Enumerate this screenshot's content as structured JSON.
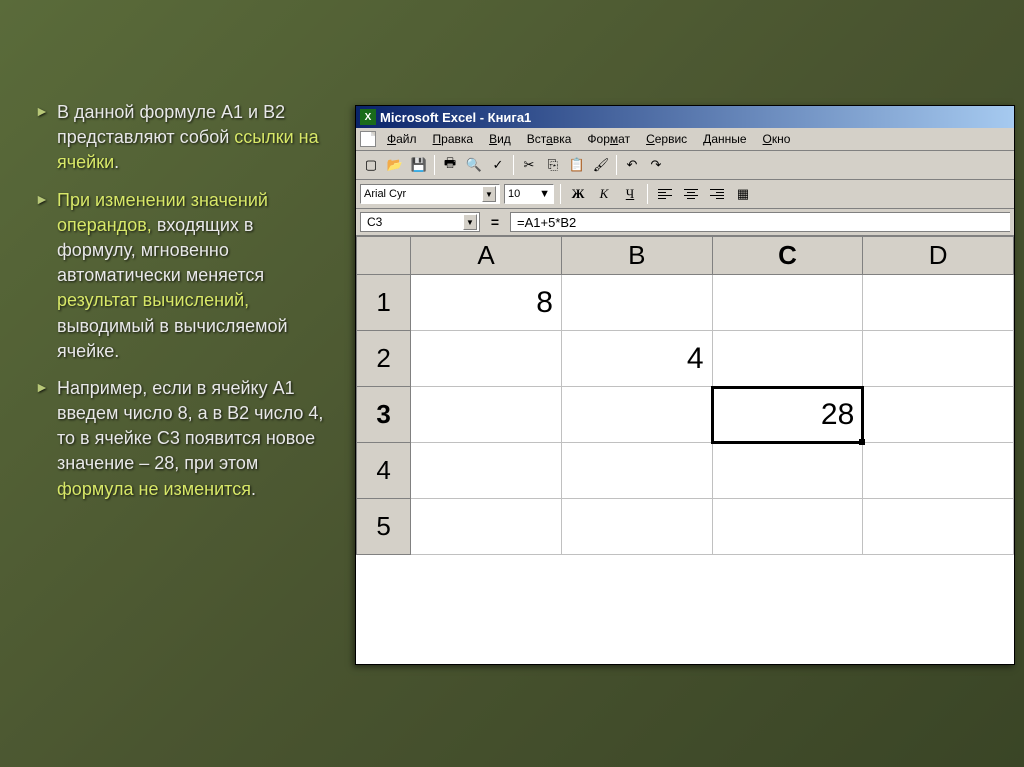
{
  "slide": {
    "bullets": [
      {
        "t1": "В данной формуле A1 и B2 представляют собой ",
        "link": "ссылки на ячейки",
        "t2": "."
      },
      {
        "highlight": "При изменении значений операндов,",
        "mid": " входящих в формулу, мгновенно автоматически меняется ",
        "highlight2": "результат вычислений,",
        "tail": " выводимый в вычисляемой ячейке."
      },
      {
        "t1": "Например, если в ячейку А1 введем число 8, а в В2 число 4, то в ячейке С3 появится новое значение – 28, при этом ",
        "highlight": "формула не изменится",
        "t2": "."
      }
    ]
  },
  "excel": {
    "title": "Microsoft Excel - Книга1",
    "menus": [
      "Файл",
      "Правка",
      "Вид",
      "Вставка",
      "Формат",
      "Сервис",
      "Данные",
      "Окно"
    ],
    "font_name": "Arial Cyr",
    "font_size": "10",
    "style_labels": {
      "bold": "Ж",
      "italic": "К",
      "underline": "Ч"
    },
    "name_box": "C3",
    "formula": "=A1+5*B2",
    "columns": [
      "A",
      "B",
      "C",
      "D"
    ],
    "rows": [
      "1",
      "2",
      "3",
      "4",
      "5"
    ],
    "active_col": "C",
    "active_row": "3",
    "cells": {
      "A1": "8",
      "B2": "4",
      "C3": "28"
    }
  }
}
